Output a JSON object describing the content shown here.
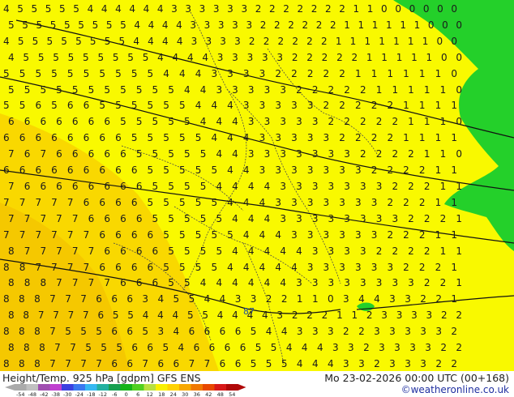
{
  "header": {
    "title": "Height/Temp. 925 hPa [gdpm] GFS ENS",
    "datetime": "Mo 23-02-2026 00:00 UTC (00+168)",
    "credit": "©weatheronline.co.uk"
  },
  "map": {
    "contour_label": "87",
    "grid_digits": [
      "4 5 5 5 5 5 4 4 4 4 4 4 3 3 3 3 3 3 2 2 2 2 2 2 2 1 1 0 0 0 0 0 0",
      "5 5 5 5 5 5 5 5 5 4 4 4 4 3 3 3 3 3 2 2 2 2 2 2 1 1 1 1 1 1 0 0 0",
      "4 5 5 5 5 5 5 5 5 4 4 4 4 3 3 3 3 2 2 2 2 2 2 1 1 1 1 1 1 1 0 0",
      "4 5 5 5 5 5 5 5 5 5 4 4 4 4 3 3 3 3 3 2 2 2 2 2 1 1 1 1 1 0 0",
      "5 5 5 5 5 5 5 5 5 5 4 4 4 3 3 3 3 2 2 2 2 2 1 1 1 1 1 1 0",
      "5 5 5 5 5 5 5 5 5 5 5 4 4 3 3 3 3 3 2 2 2 2 2 1 1 1 1 1 0",
      "5 5 6 5 6 6 5 5 5 5 5 5 4 4 4 3 3 3 3 3 2 2 2 2 2 1 1 1 1",
      "6 6 6 6 6 6 6 5 5 5 5 5 4 4 4 3 3 3 3 3 2 2 2 2 2 1 1 1 0",
      "6 6 6 6 6 6 6 6 5 5 5 5 5 4 4 4 3 3 3 3 3 2 2 2 2 1 1 1 1",
      "7 6 7 6 6 6 6 6 5 5 5 5 5 4 4 3 3 3 3 3 3 3 2 2 2 2 1 1 0",
      "6 6 6 6 6 6 6 6 6 5 5 5 5 5 4 4 3 3 3 3 3 3 3 2 2 2 2 1 1",
      "7 6 6 6 6 6 6 6 6 5 5 5 5 4 4 4 4 3 3 3 3 3 3 3 2 2 2 1 1",
      "7 7 7 7 7 6 6 6 6 5 5 5 5 5 4 4 4 3 3 3 3 3 3 3 2 2 2 1 1",
      "7 7 7 7 7 6 6 6 6 5 5 5 5 5 4 4 4 3 3 3 3 3 3 3 3 2 2 2 1",
      "7 7 7 7 7 7 6 6 6 6 5 5 5 5 5 4 4 4 3 3 3 3 3 3 2 2 2 1 1",
      "8 7 7 7 7 7 6 6 6 6 5 5 5 5 4 4 4 4 4 3 3 3 3 2 2 2 2 1 1",
      "8 8 7 7 7 7 6 6 6 6 5 5 5 5 4 4 4 4 4 3 3 3 3 3 3 2 2 2 1",
      "8 8 8 7 7 7 7 6 6 6 5 5 4 4 4 4 4 4 3 3 3 3 3 3 3 3 2 2 1",
      "8 8 8 7 7 7 6 6 6 3 4 5 5 4 4 3 3 2 2 1 1 0 3 4 4 3 3 2 2 1",
      "8 8 7 7 7 7 6 5 5 4 4 4 5 5 4 4 4 4 3 2 2 2 1 1 2 3 3 3 3 2 2",
      "8 8 8 7 5 5 5 6 6 5 3 4 6 6 6 6 5 4 4 3 3 3 2 2 3 3 3 3 3 2",
      "8 8 8 7 7 5 5 5 6 6 5 4 6 6 6 6 5 5 4 4 4 3 3 2 3 3 3 3 2 2",
      "8 8 8 7 7 7 7 6 6 7 6 6 7 7 6 6 5 5 5 4 4 4 3 3 2 3 3 3 2 2"
    ]
  },
  "legend": {
    "scale_labels": [
      "-54",
      "-48",
      "-42",
      "-38",
      "-30",
      "-24",
      "-18",
      "-12",
      "-6",
      "0",
      "6",
      "12",
      "18",
      "24",
      "30",
      "36",
      "42",
      "48",
      "54"
    ],
    "colors": [
      "#aaaaaa",
      "#c0c0c0",
      "#a04fb0",
      "#c040d0",
      "#3b40e0",
      "#3a78f0",
      "#36b8f2",
      "#22b0a0",
      "#18a050",
      "#15b418",
      "#50d020",
      "#b8e040",
      "#f8f000",
      "#ffd200",
      "#f8a800",
      "#f07800",
      "#e84800",
      "#d81818",
      "#b00808"
    ]
  }
}
